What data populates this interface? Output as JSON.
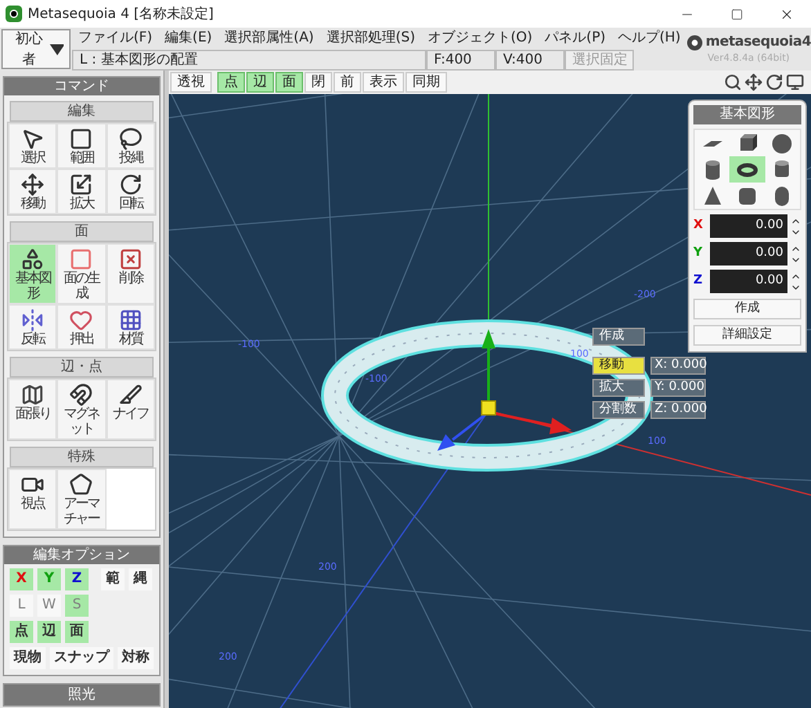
{
  "window": {
    "title": "Metasequoia 4 [名称未設定]"
  },
  "mode_select": {
    "value": "初心者"
  },
  "menu": [
    "ファイル(F)",
    "編集(E)",
    "選択部属性(A)",
    "選択部処理(S)",
    "オブジェクト(O)",
    "パネル(P)",
    "ヘルプ(H)"
  ],
  "status": {
    "hint": "L : 基本図形の配置",
    "faces": "F:400",
    "vertices": "V:400",
    "lock_button": {
      "label": "選択固定",
      "disabled": true
    }
  },
  "logo": {
    "name": "metasequoia4",
    "version": "Ver4.8.4a (64bit)"
  },
  "view_toolbar": [
    {
      "label": "透視",
      "selected": false
    },
    {
      "label": "点",
      "selected": true
    },
    {
      "label": "辺",
      "selected": true
    },
    {
      "label": "面",
      "selected": true
    },
    {
      "label": "閉",
      "selected": false
    },
    {
      "label": "前",
      "selected": false
    },
    {
      "label": "表示",
      "selected": false
    },
    {
      "label": "同期",
      "selected": false
    }
  ],
  "command_panel": {
    "title": "コマンド",
    "sections": [
      {
        "title": "編集",
        "tools": [
          {
            "label": "選択",
            "kind": "select",
            "selected": false
          },
          {
            "label": "範囲",
            "kind": "range",
            "selected": false
          },
          {
            "label": "投縄",
            "kind": "lasso",
            "selected": false
          },
          {
            "label": "移動",
            "kind": "move",
            "selected": false
          },
          {
            "label": "拡大",
            "kind": "scale",
            "selected": false
          },
          {
            "label": "回転",
            "kind": "rotate",
            "selected": false
          }
        ]
      },
      {
        "title": "面",
        "tools": [
          {
            "label": "基本図形",
            "kind": "primitive",
            "selected": true
          },
          {
            "label": "面の生成",
            "kind": "face",
            "selected": false
          },
          {
            "label": "削除",
            "kind": "delete",
            "selected": false
          },
          {
            "label": "反転",
            "kind": "flip",
            "selected": false
          },
          {
            "label": "押出",
            "kind": "extrude",
            "selected": false
          },
          {
            "label": "材質",
            "kind": "material",
            "selected": false
          }
        ]
      },
      {
        "title": "辺・点",
        "tools": [
          {
            "label": "面張り",
            "kind": "fill",
            "selected": false
          },
          {
            "label": "マグネット",
            "kind": "magnet",
            "selected": false
          },
          {
            "label": "ナイフ",
            "kind": "knife",
            "selected": false
          }
        ]
      },
      {
        "title": "特殊",
        "tools": [
          {
            "label": "視点",
            "kind": "camera",
            "selected": false
          },
          {
            "label": "アーマチャー",
            "kind": "armature",
            "selected": false
          }
        ]
      }
    ]
  },
  "edit_options": {
    "title": "編集オプション",
    "groups": [
      {
        "buttons": [
          {
            "label": "X",
            "kind": "xaxis",
            "selected": true,
            "disabled": false
          },
          {
            "label": "Y",
            "kind": "yaxis",
            "selected": true,
            "disabled": false
          },
          {
            "label": "Z",
            "kind": "zaxis",
            "selected": true,
            "disabled": false
          },
          {
            "label": "範",
            "kind": "text",
            "selected": false,
            "disabled": false
          },
          {
            "label": "縄",
            "kind": "text",
            "selected": false,
            "disabled": false
          }
        ]
      },
      {
        "buttons": [
          {
            "label": "L",
            "kind": "text",
            "selected": false,
            "disabled": true
          },
          {
            "label": "W",
            "kind": "text",
            "selected": false,
            "disabled": true
          },
          {
            "label": "S",
            "kind": "text",
            "selected": true,
            "disabled": true
          }
        ]
      },
      {
        "buttons": [
          {
            "label": "点",
            "kind": "text",
            "selected": true,
            "disabled": false
          },
          {
            "label": "辺",
            "kind": "text",
            "selected": true,
            "disabled": false
          },
          {
            "label": "面",
            "kind": "text",
            "selected": true,
            "disabled": false
          }
        ]
      },
      {
        "buttons": [
          {
            "label": "現物",
            "kind": "text",
            "selected": false,
            "disabled": false
          },
          {
            "label": "スナップ",
            "kind": "text",
            "selected": false,
            "disabled": false
          },
          {
            "label": "対称",
            "kind": "text",
            "selected": false,
            "disabled": false
          }
        ]
      }
    ]
  },
  "lighting_panel": {
    "title": "照光"
  },
  "viewport": {
    "grid_labels": [
      "-200",
      "-100",
      "-100",
      "100",
      "100",
      "200",
      "200"
    ],
    "tool_menu": {
      "create": "作成",
      "actions": [
        {
          "label": "移動",
          "selected": true,
          "value": "X: 0.000"
        },
        {
          "label": "拡大",
          "selected": false,
          "value": "Y: 0.000"
        },
        {
          "label": "分割数",
          "selected": false,
          "value": "Z: 0.000"
        }
      ]
    }
  },
  "primitive_panel": {
    "title": "基本図形",
    "shapes": [
      {
        "kind": "plane",
        "selected": false
      },
      {
        "kind": "cube",
        "selected": false
      },
      {
        "kind": "sphere",
        "selected": false
      },
      {
        "kind": "cylinder",
        "selected": false
      },
      {
        "kind": "torus",
        "selected": true
      },
      {
        "kind": "pipe",
        "selected": false
      },
      {
        "kind": "cone",
        "selected": false
      },
      {
        "kind": "rounded-cube",
        "selected": false
      },
      {
        "kind": "capsule",
        "selected": false
      }
    ],
    "fields": [
      {
        "label": "X",
        "color": "#e01010",
        "value": "0.00"
      },
      {
        "label": "Y",
        "color": "#10a010",
        "value": "0.00"
      },
      {
        "label": "Z",
        "color": "#1010d0",
        "value": "0.00"
      }
    ],
    "buttons": [
      "作成",
      "詳細設定"
    ]
  }
}
